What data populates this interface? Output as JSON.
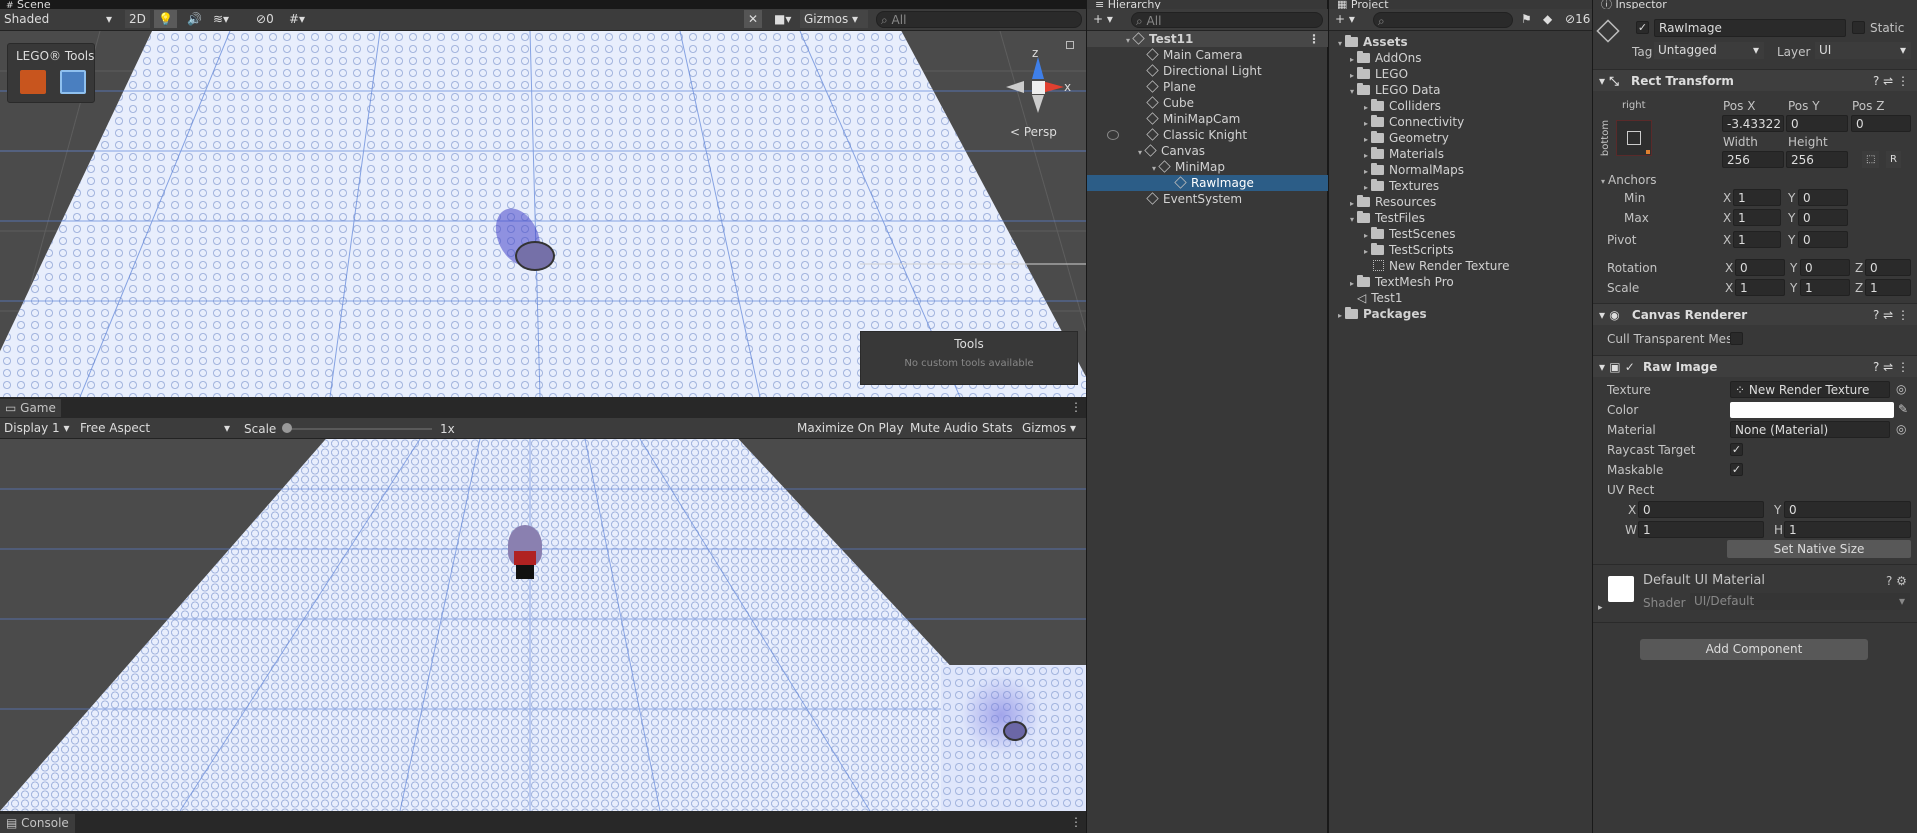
{
  "tabs": {
    "scene": "Scene",
    "hierarchy": "Hierarchy",
    "project": "Project",
    "inspector": "Inspector",
    "game": "Game",
    "console": "Console"
  },
  "scene": {
    "shading": "Shaded",
    "mode2d": "2D",
    "hidden_count": "0",
    "gizmos": "Gizmos",
    "search_placeholder": "All",
    "persp": "< Persp",
    "axis_x": "x",
    "axis_z": "z",
    "lego_tools": "LEGO® Tools",
    "tools_title": "Tools",
    "tools_msg": "No custom tools available"
  },
  "game": {
    "display": "Display 1",
    "aspect": "Free Aspect",
    "scale_label": "Scale",
    "scale_value": "1x",
    "maximize": "Maximize On Play",
    "mute": "Mute Audio",
    "stats": "Stats",
    "gizmos": "Gizmos"
  },
  "hierarchy": {
    "search_placeholder": "All",
    "root": "Test11",
    "items": [
      "Main Camera",
      "Directional Light",
      "Plane",
      "Cube",
      "MiniMapCam",
      "Classic Knight",
      "Canvas",
      "MiniMap",
      "RawImage",
      "EventSystem"
    ]
  },
  "project": {
    "count": "16",
    "tree": [
      "Assets",
      "AddOns",
      "LEGO",
      "LEGO Data",
      "Colliders",
      "Connectivity",
      "Geometry",
      "Materials",
      "NormalMaps",
      "Textures",
      "Resources",
      "TestFiles",
      "TestScenes",
      "TestScripts",
      "New Render Texture",
      "TextMesh Pro",
      "Test1",
      "Packages"
    ]
  },
  "inspector": {
    "name": "RawImage",
    "static": "Static",
    "tag_label": "Tag",
    "tag": "Untagged",
    "layer_label": "Layer",
    "layer": "UI",
    "rect_transform": "Rect Transform",
    "anchor_right": "right",
    "anchor_bottom": "bottom",
    "posx_label": "Pos X",
    "posy_label": "Pos Y",
    "posz_label": "Pos Z",
    "posx": "-3.43322",
    "posy": "0",
    "posz": "0",
    "width_label": "Width",
    "height_label": "Height",
    "width": "256",
    "height": "256",
    "r_btn": "R",
    "anchors": "Anchors",
    "min": "Min",
    "max": "Max",
    "min_x": "1",
    "min_y": "0",
    "max_x": "1",
    "max_y": "0",
    "pivot": "Pivot",
    "pivot_x": "1",
    "pivot_y": "0",
    "rotation": "Rotation",
    "rot_x": "0",
    "rot_y": "0",
    "rot_z": "0",
    "scale": "Scale",
    "scale_x": "1",
    "scale_y": "1",
    "scale_z": "1",
    "x": "X",
    "y": "Y",
    "z": "Z",
    "w": "W",
    "h": "H",
    "canvas_renderer": "Canvas Renderer",
    "cull": "Cull Transparent Mes",
    "raw_image": "Raw Image",
    "texture_label": "Texture",
    "texture": "New Render Texture",
    "color_label": "Color",
    "material_label": "Material",
    "material": "None (Material)",
    "raycast": "Raycast Target",
    "maskable": "Maskable",
    "uvrect": "UV Rect",
    "uv_x": "0",
    "uv_y": "0",
    "uv_w": "1",
    "uv_h": "1",
    "native": "Set Native Size",
    "default_mat": "Default UI Material",
    "shader_label": "Shader",
    "shader": "UI/Default",
    "add": "Add Component"
  }
}
